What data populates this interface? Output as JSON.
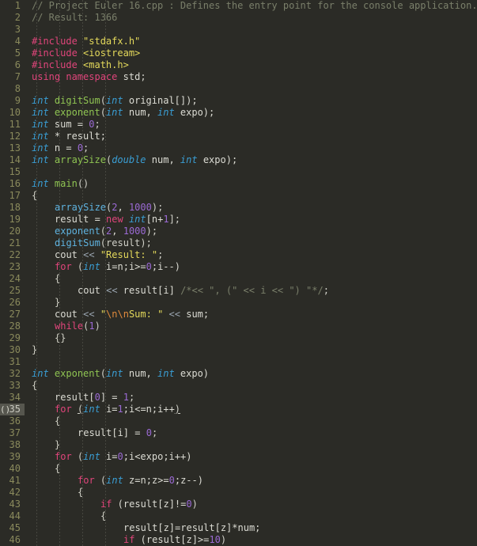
{
  "editor": {
    "background": "#2b2b26",
    "gutter_color": "#8a8a5c",
    "current_line": 35,
    "bracket_indicator": "()",
    "first_line": 1,
    "last_line": 46,
    "language": "C++",
    "colors": {
      "comment": "#7a7f6a",
      "keyword": "#e0457b",
      "type": "#3a9ed4",
      "function_def": "#8fc452",
      "function_call": "#5fb3e0",
      "number": "#9b6ad4",
      "string": "#e4d95b",
      "escape": "#e08a3c",
      "operator": "#9aa5b0",
      "plain": "#dcdcd4",
      "current_line_bg": "#56564e"
    },
    "indent_guides_x": [
      46,
      75,
      104,
      133
    ]
  },
  "lines": [
    {
      "n": 1,
      "indent": 0,
      "tokens": [
        {
          "t": "// Project Euler 16.cpp : Defines the entry point for the console application.",
          "c": "comment"
        }
      ]
    },
    {
      "n": 2,
      "indent": 0,
      "tokens": [
        {
          "t": "// Result: 1366",
          "c": "comment"
        }
      ]
    },
    {
      "n": 3,
      "indent": 0,
      "tokens": []
    },
    {
      "n": 4,
      "indent": 0,
      "tokens": [
        {
          "t": "#include",
          "c": "inc"
        },
        {
          "t": " ",
          "c": "plain"
        },
        {
          "t": "\"stdafx.h\"",
          "c": "str"
        }
      ]
    },
    {
      "n": 5,
      "indent": 0,
      "tokens": [
        {
          "t": "#include",
          "c": "inc"
        },
        {
          "t": " ",
          "c": "plain"
        },
        {
          "t": "<iostream>",
          "c": "str"
        }
      ]
    },
    {
      "n": 6,
      "indent": 0,
      "tokens": [
        {
          "t": "#include",
          "c": "inc"
        },
        {
          "t": " ",
          "c": "plain"
        },
        {
          "t": "<math.h>",
          "c": "str"
        }
      ]
    },
    {
      "n": 7,
      "indent": 0,
      "tokens": [
        {
          "t": "using",
          "c": "kw"
        },
        {
          "t": " ",
          "c": "plain"
        },
        {
          "t": "namespace",
          "c": "kw"
        },
        {
          "t": " ",
          "c": "plain"
        },
        {
          "t": "std",
          "c": "plain"
        },
        {
          "t": ";",
          "c": "punct"
        }
      ]
    },
    {
      "n": 8,
      "indent": 0,
      "tokens": []
    },
    {
      "n": 9,
      "indent": 0,
      "tokens": [
        {
          "t": "int",
          "c": "type"
        },
        {
          "t": " ",
          "c": "plain"
        },
        {
          "t": "digitSum",
          "c": "func"
        },
        {
          "t": "(",
          "c": "punct"
        },
        {
          "t": "int",
          "c": "type"
        },
        {
          "t": " original[]);",
          "c": "plain"
        }
      ]
    },
    {
      "n": 10,
      "indent": 0,
      "tokens": [
        {
          "t": "int",
          "c": "type"
        },
        {
          "t": " ",
          "c": "plain"
        },
        {
          "t": "exponent",
          "c": "func"
        },
        {
          "t": "(",
          "c": "punct"
        },
        {
          "t": "int",
          "c": "type"
        },
        {
          "t": " num, ",
          "c": "plain"
        },
        {
          "t": "int",
          "c": "type"
        },
        {
          "t": " expo);",
          "c": "plain"
        }
      ]
    },
    {
      "n": 11,
      "indent": 0,
      "tokens": [
        {
          "t": "int",
          "c": "type"
        },
        {
          "t": " sum = ",
          "c": "plain"
        },
        {
          "t": "0",
          "c": "num"
        },
        {
          "t": ";",
          "c": "punct"
        }
      ]
    },
    {
      "n": 12,
      "indent": 0,
      "tokens": [
        {
          "t": "int",
          "c": "type"
        },
        {
          "t": " * result;",
          "c": "plain"
        }
      ]
    },
    {
      "n": 13,
      "indent": 0,
      "tokens": [
        {
          "t": "int",
          "c": "type"
        },
        {
          "t": " n = ",
          "c": "plain"
        },
        {
          "t": "0",
          "c": "num"
        },
        {
          "t": ";",
          "c": "punct"
        }
      ]
    },
    {
      "n": 14,
      "indent": 0,
      "tokens": [
        {
          "t": "int",
          "c": "type"
        },
        {
          "t": " ",
          "c": "plain"
        },
        {
          "t": "arraySize",
          "c": "func"
        },
        {
          "t": "(",
          "c": "punct"
        },
        {
          "t": "double",
          "c": "type"
        },
        {
          "t": " num, ",
          "c": "plain"
        },
        {
          "t": "int",
          "c": "type"
        },
        {
          "t": " expo);",
          "c": "plain"
        }
      ]
    },
    {
      "n": 15,
      "indent": 0,
      "tokens": []
    },
    {
      "n": 16,
      "indent": 0,
      "tokens": [
        {
          "t": "int",
          "c": "type"
        },
        {
          "t": " ",
          "c": "plain"
        },
        {
          "t": "main",
          "c": "func"
        },
        {
          "t": "()",
          "c": "punct"
        }
      ]
    },
    {
      "n": 17,
      "indent": 0,
      "tokens": [
        {
          "t": "{",
          "c": "brace"
        }
      ]
    },
    {
      "n": 18,
      "indent": 1,
      "tokens": [
        {
          "t": "arraySize",
          "c": "call"
        },
        {
          "t": "(",
          "c": "punct"
        },
        {
          "t": "2",
          "c": "num"
        },
        {
          "t": ", ",
          "c": "plain"
        },
        {
          "t": "1000",
          "c": "num"
        },
        {
          "t": ");",
          "c": "punct"
        }
      ]
    },
    {
      "n": 19,
      "indent": 1,
      "tokens": [
        {
          "t": "result = ",
          "c": "plain"
        },
        {
          "t": "new",
          "c": "kw"
        },
        {
          "t": " ",
          "c": "plain"
        },
        {
          "t": "int",
          "c": "type"
        },
        {
          "t": "[n+",
          "c": "plain"
        },
        {
          "t": "1",
          "c": "num"
        },
        {
          "t": "];",
          "c": "punct"
        }
      ]
    },
    {
      "n": 20,
      "indent": 1,
      "tokens": [
        {
          "t": "exponent",
          "c": "call"
        },
        {
          "t": "(",
          "c": "punct"
        },
        {
          "t": "2",
          "c": "num"
        },
        {
          "t": ", ",
          "c": "plain"
        },
        {
          "t": "1000",
          "c": "num"
        },
        {
          "t": ");",
          "c": "punct"
        }
      ]
    },
    {
      "n": 21,
      "indent": 1,
      "tokens": [
        {
          "t": "digitSum",
          "c": "call"
        },
        {
          "t": "(result);",
          "c": "punct"
        }
      ]
    },
    {
      "n": 22,
      "indent": 1,
      "tokens": [
        {
          "t": "cout ",
          "c": "plain"
        },
        {
          "t": "<<",
          "c": "op"
        },
        {
          "t": " ",
          "c": "plain"
        },
        {
          "t": "\"Result: \"",
          "c": "str"
        },
        {
          "t": ";",
          "c": "punct"
        }
      ]
    },
    {
      "n": 23,
      "indent": 1,
      "tokens": [
        {
          "t": "for",
          "c": "kw"
        },
        {
          "t": " (",
          "c": "punct"
        },
        {
          "t": "int",
          "c": "type"
        },
        {
          "t": " i=n;i>=",
          "c": "plain"
        },
        {
          "t": "0",
          "c": "num"
        },
        {
          "t": ";i--)",
          "c": "plain"
        }
      ]
    },
    {
      "n": 24,
      "indent": 1,
      "tokens": [
        {
          "t": "{",
          "c": "brace"
        }
      ]
    },
    {
      "n": 25,
      "indent": 2,
      "tokens": [
        {
          "t": "cout ",
          "c": "plain"
        },
        {
          "t": "<<",
          "c": "op"
        },
        {
          "t": " result[i] ",
          "c": "plain"
        },
        {
          "t": "/*<< \", (\" << i << \") \"*/",
          "c": "comment"
        },
        {
          "t": ";",
          "c": "punct"
        }
      ]
    },
    {
      "n": 26,
      "indent": 1,
      "tokens": [
        {
          "t": "}",
          "c": "brace"
        }
      ]
    },
    {
      "n": 27,
      "indent": 1,
      "tokens": [
        {
          "t": "cout ",
          "c": "plain"
        },
        {
          "t": "<<",
          "c": "op"
        },
        {
          "t": " ",
          "c": "plain"
        },
        {
          "t": "\"",
          "c": "str"
        },
        {
          "t": "\\n\\n",
          "c": "esc"
        },
        {
          "t": "Sum: \"",
          "c": "str"
        },
        {
          "t": " ",
          "c": "plain"
        },
        {
          "t": "<<",
          "c": "op"
        },
        {
          "t": " sum;",
          "c": "plain"
        }
      ]
    },
    {
      "n": 28,
      "indent": 1,
      "tokens": [
        {
          "t": "while",
          "c": "kw"
        },
        {
          "t": "(",
          "c": "punct"
        },
        {
          "t": "1",
          "c": "num"
        },
        {
          "t": ")",
          "c": "punct"
        }
      ]
    },
    {
      "n": 29,
      "indent": 1,
      "tokens": [
        {
          "t": "{}",
          "c": "brace"
        }
      ]
    },
    {
      "n": 30,
      "indent": 0,
      "tokens": [
        {
          "t": "}",
          "c": "brace"
        }
      ]
    },
    {
      "n": 31,
      "indent": 0,
      "tokens": []
    },
    {
      "n": 32,
      "indent": 0,
      "tokens": [
        {
          "t": "int",
          "c": "type"
        },
        {
          "t": " ",
          "c": "plain"
        },
        {
          "t": "exponent",
          "c": "func"
        },
        {
          "t": "(",
          "c": "punct"
        },
        {
          "t": "int",
          "c": "type"
        },
        {
          "t": " num, ",
          "c": "plain"
        },
        {
          "t": "int",
          "c": "type"
        },
        {
          "t": " expo)",
          "c": "plain"
        }
      ]
    },
    {
      "n": 33,
      "indent": 0,
      "tokens": [
        {
          "t": "{",
          "c": "brace"
        }
      ]
    },
    {
      "n": 34,
      "indent": 1,
      "tokens": [
        {
          "t": "result[",
          "c": "plain"
        },
        {
          "t": "0",
          "c": "num"
        },
        {
          "t": "] = ",
          "c": "plain"
        },
        {
          "t": "1",
          "c": "num"
        },
        {
          "t": ";",
          "c": "punct"
        }
      ]
    },
    {
      "n": 35,
      "indent": 1,
      "current": true,
      "tokens": [
        {
          "t": "for",
          "c": "kw"
        },
        {
          "t": " ",
          "c": "plain"
        },
        {
          "t": "(",
          "c": "punct",
          "ul": true
        },
        {
          "t": "int",
          "c": "type"
        },
        {
          "t": " i=",
          "c": "plain"
        },
        {
          "t": "1",
          "c": "num"
        },
        {
          "t": ";i<=n;i++",
          "c": "plain"
        },
        {
          "t": ")",
          "c": "punct",
          "ul": true
        }
      ]
    },
    {
      "n": 36,
      "indent": 1,
      "tokens": [
        {
          "t": "{",
          "c": "brace"
        }
      ]
    },
    {
      "n": 37,
      "indent": 2,
      "tokens": [
        {
          "t": "result[i] = ",
          "c": "plain"
        },
        {
          "t": "0",
          "c": "num"
        },
        {
          "t": ";",
          "c": "punct"
        }
      ]
    },
    {
      "n": 38,
      "indent": 1,
      "tokens": [
        {
          "t": "}",
          "c": "brace"
        }
      ]
    },
    {
      "n": 39,
      "indent": 1,
      "tokens": [
        {
          "t": "for",
          "c": "kw"
        },
        {
          "t": " (",
          "c": "punct"
        },
        {
          "t": "int",
          "c": "type"
        },
        {
          "t": " i=",
          "c": "plain"
        },
        {
          "t": "0",
          "c": "num"
        },
        {
          "t": ";i<expo;i++)",
          "c": "plain"
        }
      ]
    },
    {
      "n": 40,
      "indent": 1,
      "tokens": [
        {
          "t": "{",
          "c": "brace"
        }
      ]
    },
    {
      "n": 41,
      "indent": 2,
      "tokens": [
        {
          "t": "for",
          "c": "kw"
        },
        {
          "t": " (",
          "c": "punct"
        },
        {
          "t": "int",
          "c": "type"
        },
        {
          "t": " z=n;z>=",
          "c": "plain"
        },
        {
          "t": "0",
          "c": "num"
        },
        {
          "t": ";z--)",
          "c": "plain"
        }
      ]
    },
    {
      "n": 42,
      "indent": 2,
      "tokens": [
        {
          "t": "{",
          "c": "brace"
        }
      ]
    },
    {
      "n": 43,
      "indent": 3,
      "tokens": [
        {
          "t": "if",
          "c": "kw"
        },
        {
          "t": " (result[z]!=",
          "c": "plain"
        },
        {
          "t": "0",
          "c": "num"
        },
        {
          "t": ")",
          "c": "punct"
        }
      ]
    },
    {
      "n": 44,
      "indent": 3,
      "tokens": [
        {
          "t": "{",
          "c": "brace"
        }
      ]
    },
    {
      "n": 45,
      "indent": 4,
      "tokens": [
        {
          "t": "result[z]=result[z]*num;",
          "c": "plain"
        }
      ]
    },
    {
      "n": 46,
      "indent": 4,
      "tokens": [
        {
          "t": "if",
          "c": "kw"
        },
        {
          "t": " (result[z]>=",
          "c": "plain"
        },
        {
          "t": "10",
          "c": "num"
        },
        {
          "t": ")",
          "c": "punct"
        }
      ]
    }
  ]
}
